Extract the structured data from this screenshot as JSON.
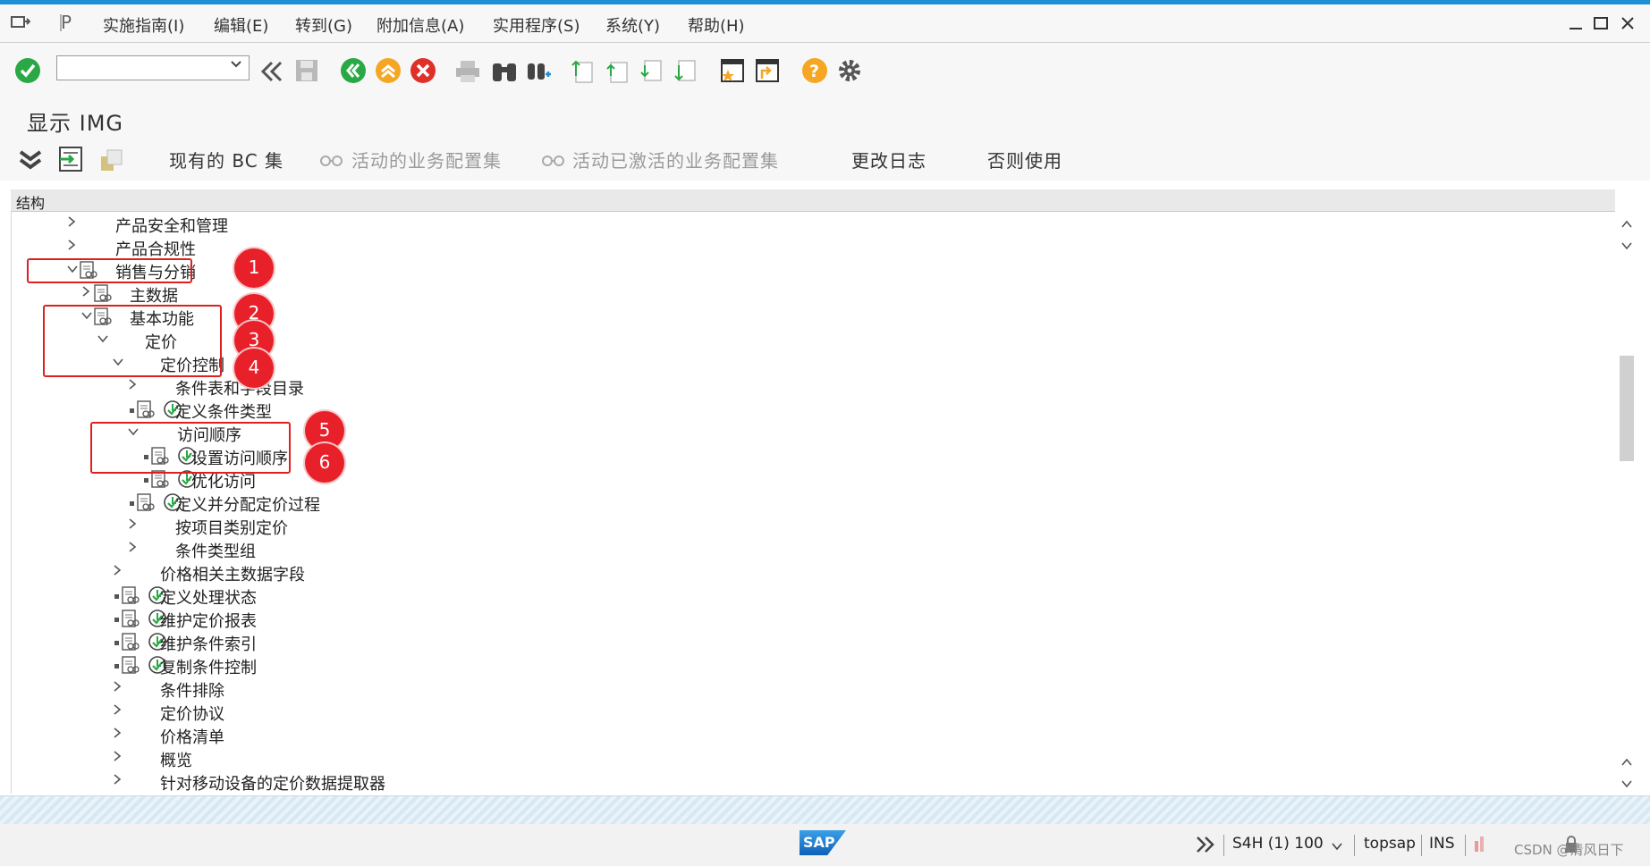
{
  "menubar": {
    "items": [
      "实施指南(I)",
      "编辑(E)",
      "转到(G)",
      "附加信息(A)",
      "实用程序(S)",
      "系统(Y)",
      "帮助(H)"
    ]
  },
  "toolbar": {
    "command_field": {
      "value": "",
      "placeholder": ""
    }
  },
  "page": {
    "title": "显示 IMG"
  },
  "app_toolbar": {
    "buttons": [
      "现有的 BC 集",
      "活动的业务配置集",
      "活动已激活的业务配置集",
      "更改日志",
      "否则使用"
    ]
  },
  "tree": {
    "column_header": "结构",
    "nodes": [
      "产品安全和管理",
      "产品合规性",
      "销售与分销",
      "主数据",
      "基本功能",
      "定价",
      "定价控制",
      "条件表和字段目录",
      "定义条件类型",
      "访问顺序",
      "设置访问顺序",
      "优化访问",
      "定义并分配定价过程",
      "按项目类别定价",
      "条件类型组",
      "价格相关主数据字段",
      "定义处理状态",
      "维护定价报表",
      "维护条件索引",
      "复制条件控制",
      "条件排除",
      "定价协议",
      "价格清单",
      "概览",
      "针对移动设备的定价数据提取器"
    ]
  },
  "annotations": {
    "badges": [
      "1",
      "2",
      "3",
      "4",
      "5",
      "6"
    ]
  },
  "status": {
    "system": "S4H (1) 100",
    "server": "topsap",
    "mode": "INS",
    "logo": "SAP",
    "watermark": "CSDN @清风日下"
  },
  "colors": {
    "accent_top": "#1e8fd6",
    "annotation_red": "#e02020",
    "ok_green": "#2aa845",
    "exit_orange": "#f5a623",
    "cancel_red": "#e0302a",
    "help_yellow": "#f5a623"
  }
}
